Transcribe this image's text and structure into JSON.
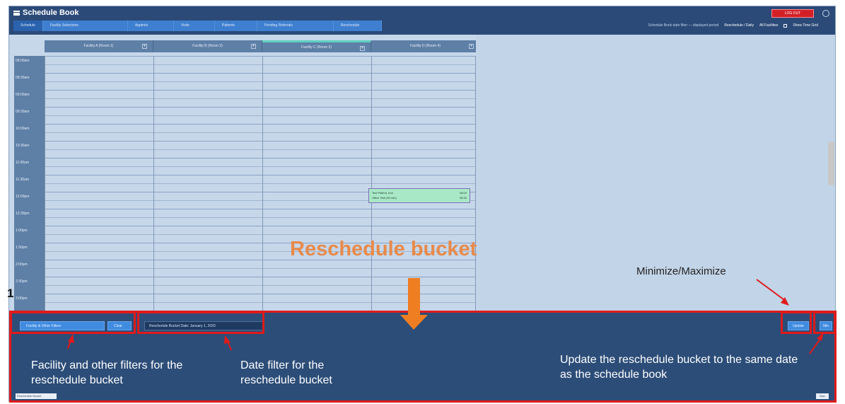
{
  "app": {
    "title": "Schedule Book",
    "nav_tabs": [
      "Schedule",
      "Facility Selections",
      "Apptmts",
      "Visits",
      "Patients",
      "Pending Referrals",
      "Reschedule"
    ],
    "header_right": {
      "info": "Schedule Book date filter — displayed period",
      "view": "Reschedule / Daily",
      "calendar": "All Facilities",
      "toggle": "Show Time Grid"
    },
    "user_badge": "LOG OUT"
  },
  "grid": {
    "columns": [
      "Facility A (Room 1)",
      "Facility B (Room 2)",
      "Facility C (Room 3)",
      "Facility D (Room 4)"
    ],
    "active_column": 2,
    "times": [
      "08:00am",
      "08:30am",
      "09:00am",
      "09:30am",
      "10:00am",
      "10:30am",
      "11:00am",
      "11:30am",
      "12:00pm",
      "12:30pm",
      "1:00pm",
      "1:30pm",
      "2:00pm",
      "2:30pm",
      "3:00pm"
    ],
    "appointment": {
      "line1_left": "Test Patient, Ann",
      "line1_right": "08:00",
      "line2_left": "Office Visit (30 min)",
      "line2_right": "08:30"
    }
  },
  "bucket": {
    "filter_buttons": [
      "Facility & Other Filters",
      "Clear"
    ],
    "date_filter": "Reschedule Bucket Date: January 1, 2020",
    "update_button": "Update",
    "toggle_button": "Min",
    "footer_left": "Reschedule Bucket",
    "footer_right": "Max"
  },
  "annotations": {
    "title": "Reschedule bucket",
    "minimize": "Minimize/Maximize",
    "facility": "Facility and other filters for the reschedule bucket",
    "date": "Date filter for the reschedule bucket",
    "update": "Update the reschedule bucket to the same date as the schedule book",
    "page_mark": "1"
  },
  "colors": {
    "header_bg": "#2b4a78",
    "tab_blue": "#3f7fd0",
    "grid_bg": "#c6d7ea",
    "appointment_bg": "#a9e8c6",
    "bucket_bg": "#2c4d78",
    "highlight_red": "#e01a1a",
    "arrow_orange": "#ef7d22",
    "caption_orange": "#e88a4a"
  }
}
